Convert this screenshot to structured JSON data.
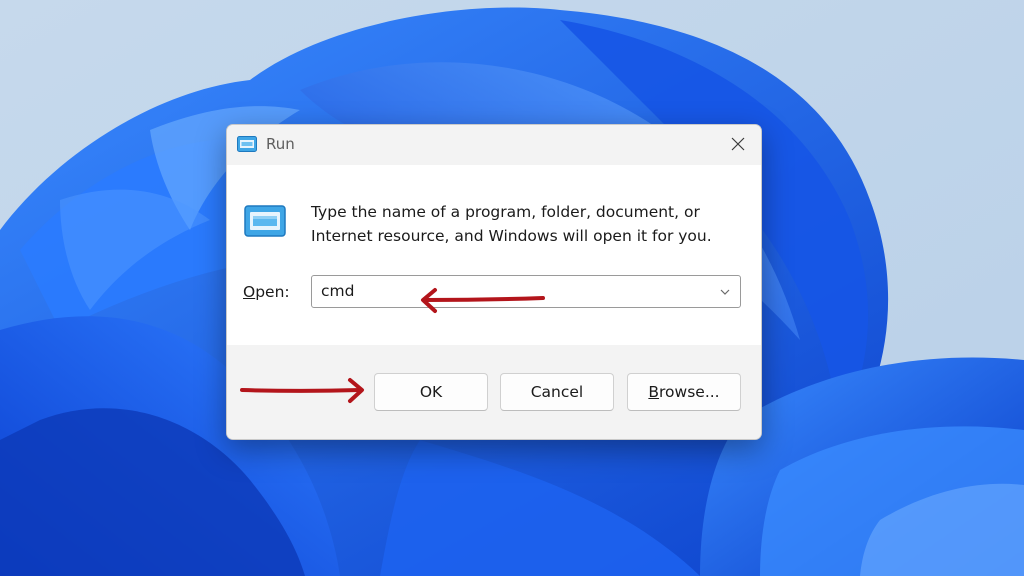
{
  "window": {
    "title": "Run",
    "close_icon": "close-icon",
    "app_icon": "run-app-icon"
  },
  "dialog": {
    "description": "Type the name of a program, folder, document, or Internet resource, and Windows will open it for you.",
    "open_label_mnemonic": "O",
    "open_label_rest": "pen:",
    "open_value": "cmd"
  },
  "buttons": {
    "ok": "OK",
    "cancel": "Cancel",
    "browse_mnemonic": "B",
    "browse_rest": "rowse..."
  },
  "annotations": {
    "arrow_color": "#b3151b",
    "arrow_to_input": "arrow-left-icon",
    "arrow_to_ok": "arrow-right-icon"
  },
  "colors": {
    "wallpaper_bg": "#c9dcec",
    "wallpaper_blue": "#1a5ff0",
    "dialog_bg": "#f3f3f3",
    "content_bg": "#ffffff"
  }
}
